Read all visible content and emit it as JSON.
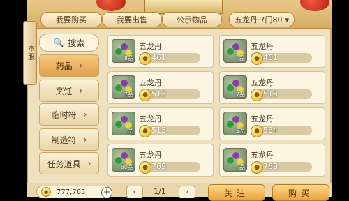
{
  "tabs": [
    {
      "label": "我要购买",
      "active": false
    },
    {
      "label": "我要出售",
      "active": false
    },
    {
      "label": "公示物品",
      "active": false
    }
  ],
  "filter_dropdown": {
    "label": "五龙丹·7门80",
    "icon": "chevron-down-icon"
  },
  "side_handle": {
    "label": "本服"
  },
  "sidebar": {
    "search_label": "搜索",
    "categories": [
      {
        "label": "药品",
        "active": true
      },
      {
        "label": "烹饪",
        "active": false
      },
      {
        "label": "临时符",
        "active": false
      },
      {
        "label": "制造符",
        "active": false
      },
      {
        "label": "任务道具",
        "active": false
      }
    ]
  },
  "items": [
    {
      "name": "五龙丹",
      "price": "461",
      "qty": "8品"
    },
    {
      "name": "五龙丹",
      "price": "461",
      "qty": "品"
    },
    {
      "name": "五龙丹",
      "price": "513",
      "qty": "7品"
    },
    {
      "name": "五龙丹",
      "price": "513",
      "qty": "7品"
    },
    {
      "name": "五龙丹",
      "price": "513",
      "qty": "品"
    },
    {
      "name": "五龙丹",
      "price": "564",
      "qty": "5品"
    },
    {
      "name": "五龙丹",
      "price": "769",
      "qty": "80品"
    },
    {
      "name": "五龙丹",
      "price": "769",
      "qty": "品"
    }
  ],
  "bottom": {
    "money": "777,765",
    "page": "1/1",
    "follow_label": "关注",
    "buy_label": "购买"
  },
  "colors": {
    "accent": "#e5a94c",
    "panel": "#efe1bd",
    "coin": "#e0b22a"
  }
}
